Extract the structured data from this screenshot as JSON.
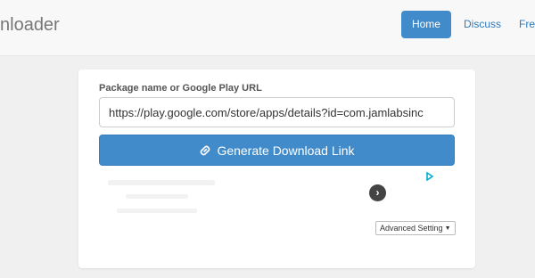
{
  "navbar": {
    "brand": "nloader",
    "items": [
      {
        "label": "Home"
      },
      {
        "label": "Discuss"
      },
      {
        "label": "Free"
      }
    ]
  },
  "form": {
    "field_label": "Package name or Google Play URL",
    "url_value": "https://play.google.com/store/apps/details?id=com.jamlabsinc",
    "generate_label": "Generate Download Link",
    "advanced_label": "Advanced Setting",
    "ad_next_glyph": "›"
  },
  "colors": {
    "accent": "#428bca",
    "link": "#337ab7",
    "adchoices": "#00aecd"
  },
  "icons": {
    "generate": "link-icon",
    "ad_next": "chevron-right-icon",
    "advanced": "caret-down-icon",
    "ad_choices": "adchoices-icon"
  }
}
